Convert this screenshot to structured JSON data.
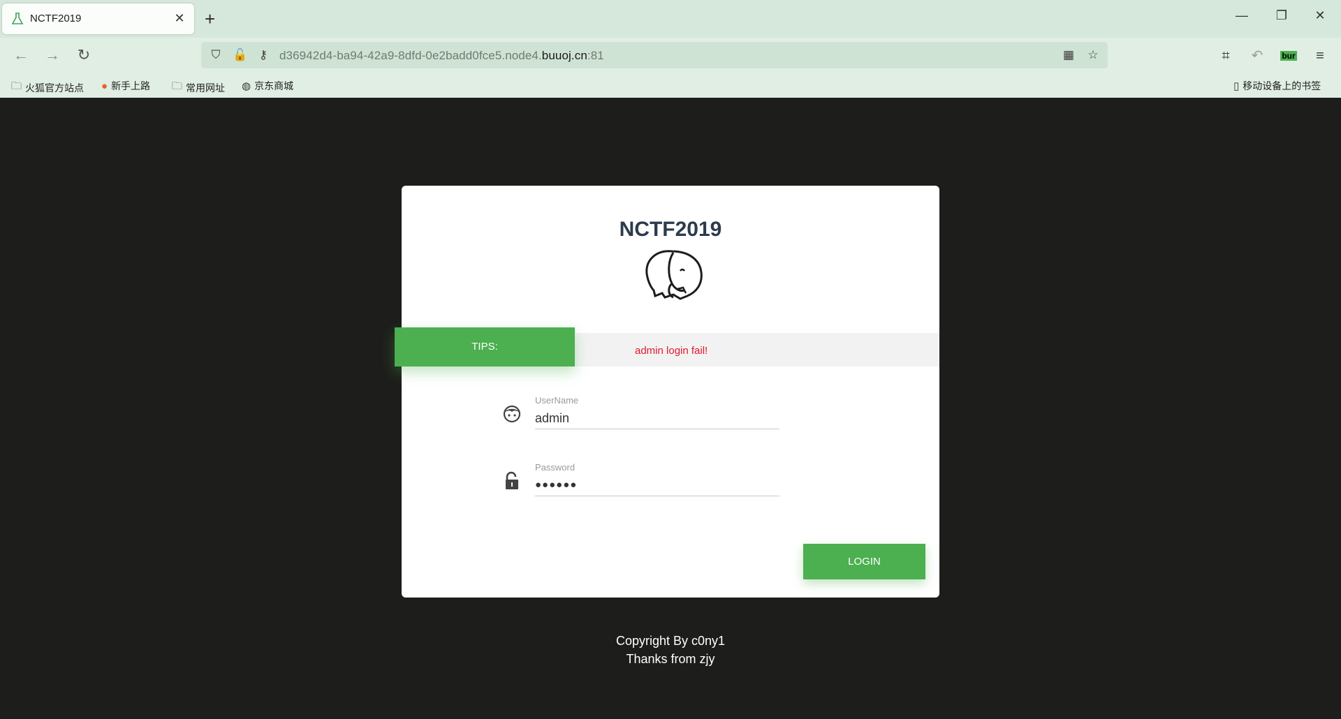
{
  "browser": {
    "tab_title": "NCTF2019",
    "url_prefix": "d36942d4-ba94-42a9-8dfd-0e2badd0fce5.node4.",
    "url_domain": "buuoj.cn",
    "url_suffix": ":81",
    "ext_badge": "bur",
    "bookmarks": [
      "火狐官方站点",
      "新手上路",
      "常用网址",
      "京东商城"
    ],
    "mobile_bookmarks": "移动设备上的书签"
  },
  "page": {
    "title": "NCTF2019",
    "tips_label": "TIPS:",
    "tips_message": "admin login fail!",
    "username_label": "UserName",
    "username_value": "admin",
    "password_label": "Password",
    "password_value": "●●●●●●",
    "login_label": "LOGIN",
    "footer_line1": "Copyright By c0ny1",
    "footer_line2": "Thanks from zjy"
  },
  "colors": {
    "accent": "#4caf50",
    "error": "#e0182b",
    "page_bg": "#1d1e1b"
  }
}
